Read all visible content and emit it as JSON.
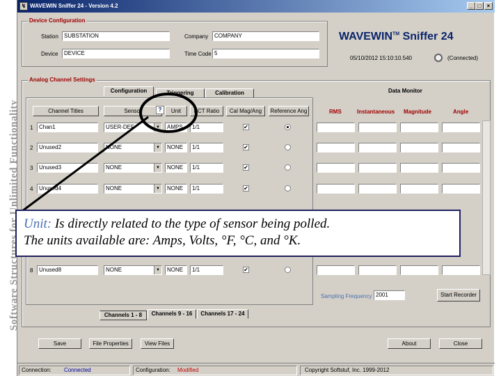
{
  "banner": {
    "text": "Software Structures for Unlimited Functionality"
  },
  "window": {
    "title": "WAVEWIN Sniffer 24 - Version 4.2",
    "min": "_",
    "max": "□",
    "close": "×"
  },
  "logo": {
    "name": "WAVEWIN",
    "tm": "TM",
    "suffix": "Sniffer 24",
    "datetime": "05/10/2012 15:10:10.540",
    "connected_label": "(Connected)"
  },
  "device_config": {
    "title": "Device Configuration",
    "station_label": "Station",
    "station_value": "SUBSTATION",
    "company_label": "Company",
    "company_value": "COMPANY",
    "device_label": "Device",
    "device_value": "DEVICE",
    "time_code_label": "Time Code",
    "time_code_value": "5"
  },
  "analog": {
    "title": "Analog Channel Settings",
    "tabs": [
      "Configuration",
      "Triggering",
      "Calibration"
    ],
    "headers": {
      "channel_titles": "Channel Titles",
      "sensor": "Sensor",
      "unit": "Unit",
      "pct_ratio": "PCT Ratio",
      "cal_mag_ang": "Cal Mag/Ang",
      "reference_ang": "Reference Ang"
    },
    "channels": [
      {
        "num": "1",
        "title": "Chan1",
        "sensor": "USER-DEF",
        "unit": "AMPS",
        "ratio": "1/1",
        "checked": "✔",
        "ref": true
      },
      {
        "num": "2",
        "title": "Unused2",
        "sensor": "NONE",
        "unit": "NONE",
        "ratio": "1/1",
        "checked": "✔",
        "ref": false
      },
      {
        "num": "3",
        "title": "Unused3",
        "sensor": "NONE",
        "unit": "NONE",
        "ratio": "1/1",
        "checked": "✔",
        "ref": false
      },
      {
        "num": "4",
        "title": "Unused4",
        "sensor": "NONE",
        "unit": "NONE",
        "ratio": "1/1",
        "checked": "✔",
        "ref": false
      },
      {
        "num": "8",
        "title": "Unused8",
        "sensor": "NONE",
        "unit": "NONE",
        "ratio": "1/1",
        "checked": "✔",
        "ref": false
      }
    ],
    "bottom_tabs": [
      "Channels 1 - 8",
      "Channels 9 - 16",
      "Channels 17 - 24"
    ]
  },
  "monitor": {
    "title": "Data Monitor",
    "headers": [
      "RMS",
      "Instantaneous",
      "Magnitude",
      "Angle"
    ],
    "sampling_label": "Sampling Frequency",
    "sampling_value": "2001",
    "start_recorder": "Start Recorder"
  },
  "buttons": {
    "save": "Save",
    "file_properties": "File Properties",
    "view_files": "View Files",
    "about": "About",
    "close": "Close"
  },
  "status": {
    "connection_label": "Connection:",
    "connection_value": "Connected",
    "config_label": "Configuration:",
    "config_value": "Modified",
    "copyright": "Copyright Softstuf, Inc. 1999-2012"
  },
  "callout": {
    "term": "Unit:",
    "line1_rest": " Is directly related to the type of sensor being polled.",
    "line2": "The units available are: Amps, Volts, °F, °C, and °K."
  },
  "icons": {
    "sensor_help": "help-icon",
    "clock": "clock-icon"
  }
}
